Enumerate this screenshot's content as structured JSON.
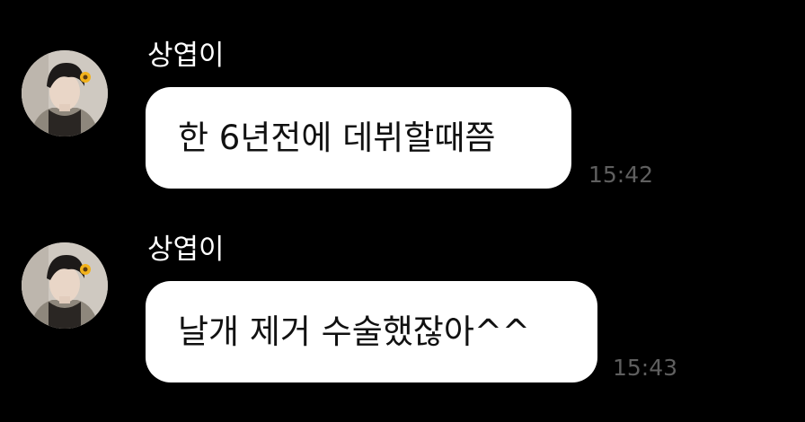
{
  "messages": [
    {
      "sender": "상엽이",
      "text": "한 6년전에 데뷔할때쯤",
      "time": "15:42",
      "avatar_icon": "profile-photo-avatar"
    },
    {
      "sender": "상엽이",
      "text": "날개 제거 수술했잖아^^",
      "time": "15:43",
      "avatar_icon": "profile-photo-avatar"
    }
  ],
  "colors": {
    "background": "#000000",
    "bubble": "#ffffff",
    "bubble_text": "#111111",
    "sender_name": "#ffffff",
    "timestamp": "#5f5f5f"
  }
}
